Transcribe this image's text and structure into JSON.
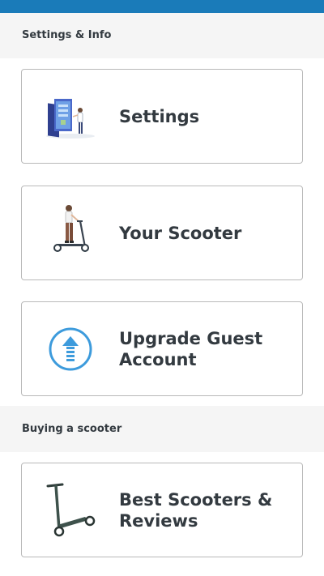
{
  "sections": [
    {
      "title": "Settings & Info"
    },
    {
      "title": "Buying a scooter"
    }
  ],
  "cards": [
    {
      "label": "Settings",
      "icon": "settings-illustration-icon"
    },
    {
      "label": "Your Scooter",
      "icon": "person-on-scooter-icon"
    },
    {
      "label": "Upgrade Guest Account",
      "icon": "upgrade-arrow-icon"
    },
    {
      "label": "Best Scooters & Reviews",
      "icon": "scooter-icon"
    }
  ],
  "colors": {
    "topbar": "#1a7bb9",
    "section_bg": "#f5f5f5",
    "card_border": "#b9b9b9",
    "text": "#333a40",
    "accent_blue": "#3d9bdc"
  }
}
